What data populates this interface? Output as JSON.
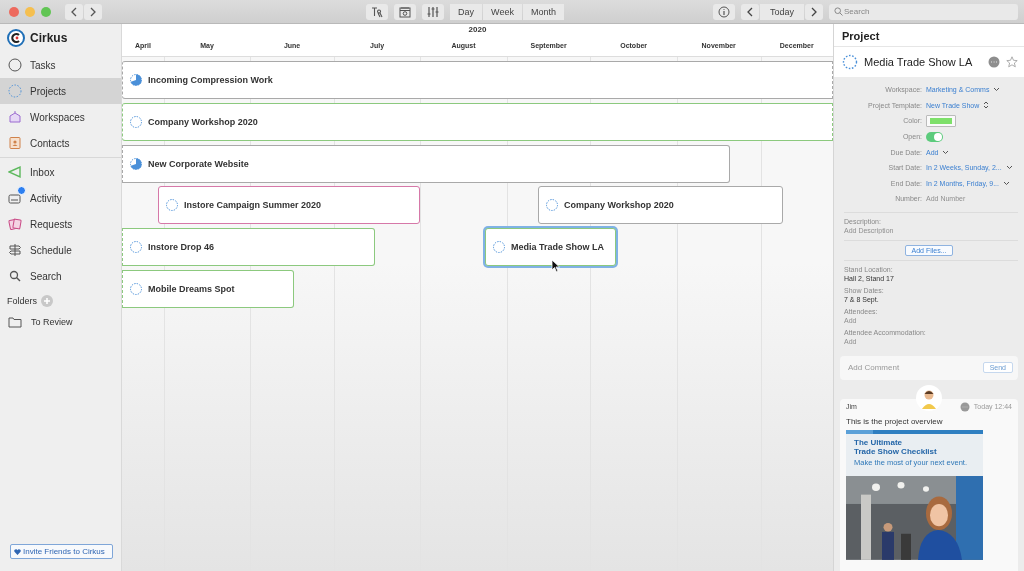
{
  "toolbar": {
    "view_modes": [
      {
        "label": "Day",
        "selected": false
      },
      {
        "label": "Week",
        "selected": false
      },
      {
        "label": "Month",
        "selected": false
      }
    ],
    "today": "Today",
    "search": {
      "placeholder": "Search"
    }
  },
  "sidebar": {
    "app_name": "Cirkus",
    "items": [
      {
        "label": "Tasks",
        "selected": false,
        "badge": false
      },
      {
        "label": "Projects",
        "selected": true,
        "badge": false
      },
      {
        "label": "Workspaces",
        "selected": false,
        "badge": false
      },
      {
        "label": "Contacts",
        "selected": false,
        "badge": false
      },
      {
        "label": "Inbox",
        "selected": false,
        "badge": false
      },
      {
        "label": "Activity",
        "selected": false,
        "badge": true
      },
      {
        "label": "Requests",
        "selected": false,
        "badge": false
      },
      {
        "label": "Schedule",
        "selected": false,
        "badge": false
      },
      {
        "label": "Search",
        "selected": false,
        "badge": false
      }
    ],
    "folders_title": "Folders",
    "folders": [
      {
        "label": "To Review",
        "selected": false
      }
    ],
    "invite": "Invite Friends to Cirkus"
  },
  "timeline": {
    "year": "2020",
    "months": [
      "April",
      "May",
      "June",
      "July",
      "August",
      "September",
      "October",
      "November",
      "December"
    ],
    "projects": [
      {
        "name": "Incoming Compression Work",
        "color": "#a9a9a9",
        "started": true,
        "selected": false
      },
      {
        "name": "Company Workshop 2020",
        "color": "#8cc97e",
        "started": false,
        "selected": false
      },
      {
        "name": "New Corporate Website",
        "color": "#a9a9a9",
        "started": true,
        "selected": false
      },
      {
        "name": "Instore Campaign Summer 2020",
        "color": "#d678a8",
        "started": false,
        "selected": false
      },
      {
        "name": "Company Workshop 2020",
        "color": "#a9a9a9",
        "started": false,
        "selected": false
      },
      {
        "name": "Instore Drop 46",
        "color": "#8cc97e",
        "started": false,
        "selected": false
      },
      {
        "name": "Media Trade Show LA",
        "color": "#8cc97e",
        "started": false,
        "selected": true
      },
      {
        "name": "Mobile Dreams Spot",
        "color": "#8cc97e",
        "started": false,
        "selected": false
      }
    ]
  },
  "inspector": {
    "title": "Project",
    "project_name": "Media Trade Show LA",
    "fields": [
      {
        "kind": "dropdown",
        "label": "Workspace:",
        "value": "Marketing & Comms"
      },
      {
        "kind": "stepper",
        "label": "Project Template:",
        "value": "New Trade Show"
      },
      {
        "kind": "color",
        "label": "Color:",
        "color": "#7ee06a"
      },
      {
        "kind": "switch",
        "label": "Open:",
        "checked": true
      },
      {
        "kind": "dropdown",
        "label": "Due Date:",
        "value": "Add"
      },
      {
        "kind": "dropdown",
        "label": "Start Date:",
        "value": "In 2 Weeks, Sunday, 2..."
      },
      {
        "kind": "dropdown",
        "label": "End Date:",
        "value": "In 2 Months, Friday, 9..."
      },
      {
        "kind": "text",
        "label": "Number:",
        "placeholder": "Add Number"
      }
    ],
    "description": {
      "label": "Description:",
      "placeholder": "Add Description"
    },
    "add_files": "Add Files...",
    "custom_fields": [
      {
        "label": "Stand Location:",
        "value": "Hall 2, Stand 17"
      },
      {
        "label": "Show Dates:",
        "value": "7 & 8 Sept."
      },
      {
        "label": "Attendees:",
        "placeholder": "Add"
      },
      {
        "label": "Attendee Accommodation:",
        "placeholder": "Add"
      }
    ],
    "comment_box": {
      "placeholder": "Add Comment",
      "send": "Send"
    },
    "comment": {
      "author": "Jim",
      "time": "Today 12:44",
      "text": "This is the project overview",
      "attachment": {
        "title_lines": [
          "The Ultimate",
          "Trade Show Checklist"
        ],
        "subtitle": "Make the most of your next event."
      }
    }
  }
}
